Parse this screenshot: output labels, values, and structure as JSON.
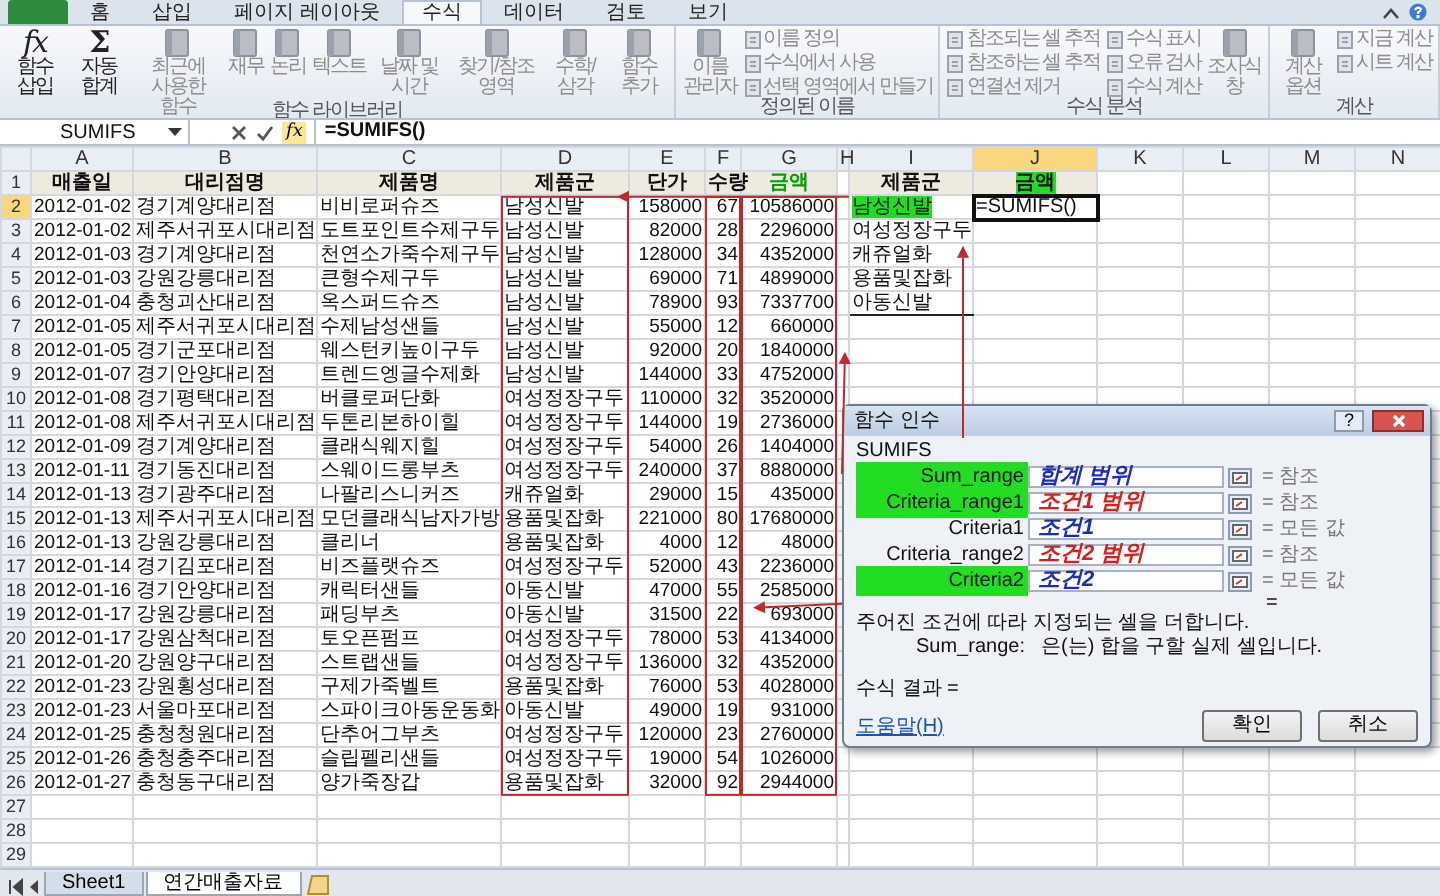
{
  "ribbon_tabs": [
    {
      "label": "홈",
      "selected": false
    },
    {
      "label": "삽입",
      "selected": false
    },
    {
      "label": "페이지 레이아웃",
      "selected": false
    },
    {
      "label": "수식",
      "selected": true
    },
    {
      "label": "데이터",
      "selected": false
    },
    {
      "label": "검토",
      "selected": false
    },
    {
      "label": "보기",
      "selected": false
    }
  ],
  "ribbon_groups": [
    {
      "label": "함수 라이브러리",
      "buttons": [
        {
          "kind": "large",
          "glyph": "fx",
          "label": "함수 삽입",
          "disabled": false
        },
        {
          "kind": "large",
          "glyph": "Σ",
          "label": "자동 합계",
          "disabled": false
        },
        {
          "kind": "large",
          "label": "최근에 사용한 함수",
          "disabled": true
        },
        {
          "kind": "large",
          "label": "재무",
          "disabled": true
        },
        {
          "kind": "large",
          "label": "논리",
          "disabled": true
        },
        {
          "kind": "large",
          "label": "텍스트",
          "disabled": true
        },
        {
          "kind": "large",
          "label": "날짜 및 시간",
          "disabled": true
        },
        {
          "kind": "large",
          "label": "찾기/참조 영역",
          "disabled": true
        },
        {
          "kind": "large",
          "label": "수학/삼각",
          "disabled": true
        },
        {
          "kind": "large",
          "label": "함수 추가",
          "disabled": true
        }
      ]
    },
    {
      "label": "정의된 이름",
      "buttons": [
        {
          "kind": "large",
          "label": "이름 관리자",
          "disabled": true
        },
        {
          "kind": "small",
          "label": "이름 정의",
          "disabled": true
        },
        {
          "kind": "small",
          "label": "수식에서 사용",
          "disabled": true
        },
        {
          "kind": "small",
          "label": "선택 영역에서 만들기",
          "disabled": true
        }
      ]
    },
    {
      "label": "수식 분석",
      "buttons": [
        {
          "kind": "small",
          "label": "참조되는 셀 추적",
          "disabled": true
        },
        {
          "kind": "small",
          "label": "참조하는 셀 추적",
          "disabled": true
        },
        {
          "kind": "small",
          "label": "연결선 제거",
          "disabled": true
        },
        {
          "kind": "small",
          "label": "수식 표시",
          "disabled": true
        },
        {
          "kind": "small",
          "label": "오류 검사",
          "disabled": true
        },
        {
          "kind": "small",
          "label": "수식 계산",
          "disabled": true
        },
        {
          "kind": "large",
          "label": "조사식 창",
          "disabled": true
        }
      ]
    },
    {
      "label": "계산",
      "buttons": [
        {
          "kind": "large",
          "label": "계산 옵션",
          "disabled": true
        },
        {
          "kind": "small",
          "label": "지금 계산",
          "disabled": true
        },
        {
          "kind": "small",
          "label": "시트 계산",
          "disabled": true
        }
      ]
    }
  ],
  "formula_bar": {
    "name_box": "SUMIFS",
    "fx": "fx",
    "formula": "=SUMIFS()"
  },
  "columns": [
    {
      "letter": "A",
      "selected": false
    },
    {
      "letter": "B",
      "selected": false
    },
    {
      "letter": "C",
      "selected": false
    },
    {
      "letter": "D",
      "selected": false
    },
    {
      "letter": "E",
      "selected": false
    },
    {
      "letter": "F",
      "selected": false
    },
    {
      "letter": "G",
      "selected": false
    },
    {
      "letter": "H",
      "selected": false
    },
    {
      "letter": "I",
      "selected": false
    },
    {
      "letter": "J",
      "selected": true
    },
    {
      "letter": "K",
      "selected": false
    },
    {
      "letter": "L",
      "selected": false
    },
    {
      "letter": "M",
      "selected": false
    },
    {
      "letter": "N",
      "selected": false
    }
  ],
  "header_row": {
    "number": "1",
    "selected": false,
    "cells": [
      {
        "text": "매출일",
        "highlighted": false
      },
      {
        "text": "대리점명",
        "highlighted": false
      },
      {
        "text": "제품명",
        "highlighted": false
      },
      {
        "text": "제품군",
        "highlighted": false
      },
      {
        "text": "단가",
        "highlighted": false
      },
      {
        "text": "수량",
        "highlighted": false
      },
      {
        "text": "금액",
        "highlighted": true
      }
    ]
  },
  "rows": [
    {
      "number": "2",
      "selected": true,
      "cells": [
        "2012-01-02",
        "경기계양대리점",
        "비비로퍼슈즈",
        "남성신발",
        "158000",
        "67",
        "10586000"
      ]
    },
    {
      "number": "3",
      "selected": false,
      "cells": [
        "2012-01-02",
        "제주서귀포시대리점",
        "도트포인트수제구두",
        "남성신발",
        "82000",
        "28",
        "2296000"
      ]
    },
    {
      "number": "4",
      "selected": false,
      "cells": [
        "2012-01-03",
        "경기계양대리점",
        "천연소가죽수제구두",
        "남성신발",
        "128000",
        "34",
        "4352000"
      ]
    },
    {
      "number": "5",
      "selected": false,
      "cells": [
        "2012-01-03",
        "강원강릉대리점",
        "큰형수제구두",
        "남성신발",
        "69000",
        "71",
        "4899000"
      ]
    },
    {
      "number": "6",
      "selected": false,
      "cells": [
        "2012-01-04",
        "충청괴산대리점",
        "옥스퍼드슈즈",
        "남성신발",
        "78900",
        "93",
        "7337700"
      ]
    },
    {
      "number": "7",
      "selected": false,
      "cells": [
        "2012-01-05",
        "제주서귀포시대리점",
        "수제남성샌들",
        "남성신발",
        "55000",
        "12",
        "660000"
      ]
    },
    {
      "number": "8",
      "selected": false,
      "cells": [
        "2012-01-05",
        "경기군포대리점",
        "웨스턴키높이구두",
        "남성신발",
        "92000",
        "20",
        "1840000"
      ]
    },
    {
      "number": "9",
      "selected": false,
      "cells": [
        "2012-01-07",
        "경기안양대리점",
        "트렌드엥글수제화",
        "남성신발",
        "144000",
        "33",
        "4752000"
      ]
    },
    {
      "number": "10",
      "selected": false,
      "cells": [
        "2012-01-08",
        "경기평택대리점",
        "버클로퍼단화",
        "여성정장구두",
        "110000",
        "32",
        "3520000"
      ]
    },
    {
      "number": "11",
      "selected": false,
      "cells": [
        "2012-01-08",
        "제주서귀포시대리점",
        "두톤리본하이힐",
        "여성정장구두",
        "144000",
        "19",
        "2736000"
      ]
    },
    {
      "number": "12",
      "selected": false,
      "cells": [
        "2012-01-09",
        "경기계양대리점",
        "클래식웨지힐",
        "여성정장구두",
        "54000",
        "26",
        "1404000"
      ]
    },
    {
      "number": "13",
      "selected": false,
      "cells": [
        "2012-01-11",
        "경기동진대리점",
        "스웨이드롱부츠",
        "여성정장구두",
        "240000",
        "37",
        "8880000"
      ]
    },
    {
      "number": "14",
      "selected": false,
      "cells": [
        "2012-01-13",
        "경기광주대리점",
        "나팔리스니커즈",
        "캐쥬얼화",
        "29000",
        "15",
        "435000"
      ]
    },
    {
      "number": "15",
      "selected": false,
      "cells": [
        "2012-01-13",
        "제주서귀포시대리점",
        "모던클래식남자가방",
        "용품및잡화",
        "221000",
        "80",
        "17680000"
      ]
    },
    {
      "number": "16",
      "selected": false,
      "cells": [
        "2012-01-13",
        "강원강릉대리점",
        "클리너",
        "용품및잡화",
        "4000",
        "12",
        "48000"
      ]
    },
    {
      "number": "17",
      "selected": false,
      "cells": [
        "2012-01-14",
        "경기김포대리점",
        "비즈플랫슈즈",
        "여성정장구두",
        "52000",
        "43",
        "2236000"
      ]
    },
    {
      "number": "18",
      "selected": false,
      "cells": [
        "2012-01-16",
        "경기안양대리점",
        "캐릭터샌들",
        "아동신발",
        "47000",
        "55",
        "2585000"
      ]
    },
    {
      "number": "19",
      "selected": false,
      "cells": [
        "2012-01-17",
        "강원강릉대리점",
        "패딩부츠",
        "아동신발",
        "31500",
        "22",
        "693000"
      ]
    },
    {
      "number": "20",
      "selected": false,
      "cells": [
        "2012-01-17",
        "강원삼척대리점",
        "토오픈펌프",
        "여성정장구두",
        "78000",
        "53",
        "4134000"
      ]
    },
    {
      "number": "21",
      "selected": false,
      "cells": [
        "2012-01-20",
        "강원양구대리점",
        "스트랩샌들",
        "여성정장구두",
        "136000",
        "32",
        "4352000"
      ]
    },
    {
      "number": "22",
      "selected": false,
      "cells": [
        "2012-01-23",
        "강원횡성대리점",
        "구제가죽벨트",
        "용품및잡화",
        "76000",
        "53",
        "4028000"
      ]
    },
    {
      "number": "23",
      "selected": false,
      "cells": [
        "2012-01-23",
        "서울마포대리점",
        "스파이크아동운동화",
        "아동신발",
        "49000",
        "19",
        "931000"
      ]
    },
    {
      "number": "24",
      "selected": false,
      "cells": [
        "2012-01-25",
        "충청청원대리점",
        "단추어그부츠",
        "여성정장구두",
        "120000",
        "23",
        "2760000"
      ]
    },
    {
      "number": "25",
      "selected": false,
      "cells": [
        "2012-01-26",
        "충청충주대리점",
        "슬립펠리샌들",
        "여성정장구두",
        "19000",
        "54",
        "1026000"
      ]
    },
    {
      "number": "26",
      "selected": false,
      "cells": [
        "2012-01-27",
        "충청동구대리점",
        "양가죽장갑",
        "용품및잡화",
        "32000",
        "92",
        "2944000"
      ]
    }
  ],
  "empty_rows": [
    "27",
    "28",
    "29"
  ],
  "lookup": {
    "headers": [
      {
        "text": "제품군",
        "highlighted": false
      },
      {
        "text": "금액",
        "highlighted": true
      }
    ],
    "groups": [
      {
        "text": "남성신발",
        "highlighted": true
      },
      {
        "text": "여성정장구두",
        "highlighted": false
      },
      {
        "text": "캐쥬얼화",
        "highlighted": false
      },
      {
        "text": "용품및잡화",
        "highlighted": false
      },
      {
        "text": "아동신발",
        "highlighted": false
      }
    ],
    "formula_cell": {
      "text": "=SUMIFS()",
      "active": true
    }
  },
  "sheet_tabs": [
    {
      "label": "Sheet1",
      "selected": false
    },
    {
      "label": "연간매출자료",
      "selected": true
    }
  ],
  "dialog": {
    "title": "함수 인수",
    "help_button": "?",
    "function_name": "SUMIFS",
    "args": [
      {
        "name": "Sum_range",
        "result": "= 참조",
        "annotation": "합계 범위",
        "color": "#1d2fb8",
        "highlighted": true
      },
      {
        "name": "Criteria_range1",
        "result": "= 참조",
        "annotation": "조건1 범위",
        "color": "#d81e1e",
        "highlighted": true
      },
      {
        "name": "Criteria1",
        "result": "= 모든 값",
        "annotation": "조건1",
        "color": "#1d2fb8",
        "highlighted": false
      },
      {
        "name": "Criteria_range2",
        "result": "= 참조",
        "annotation": "조건2 범위",
        "color": "#d81e1e",
        "highlighted": false
      },
      {
        "name": "Criteria2",
        "result": "= 모든 값",
        "annotation": "조건2",
        "color": "#1d2fb8",
        "highlighted": true
      }
    ],
    "total": "=",
    "description": "주어진 조건에 따라 지정되는 셀을 더합니다.",
    "arg_help_name": "Sum_range:",
    "arg_help": "은(는) 합을 구할 실제 셀입니다.",
    "result_label": "수식 결과 =",
    "help_link": "도움말(H)",
    "buttons": [
      "확인",
      "취소"
    ]
  }
}
